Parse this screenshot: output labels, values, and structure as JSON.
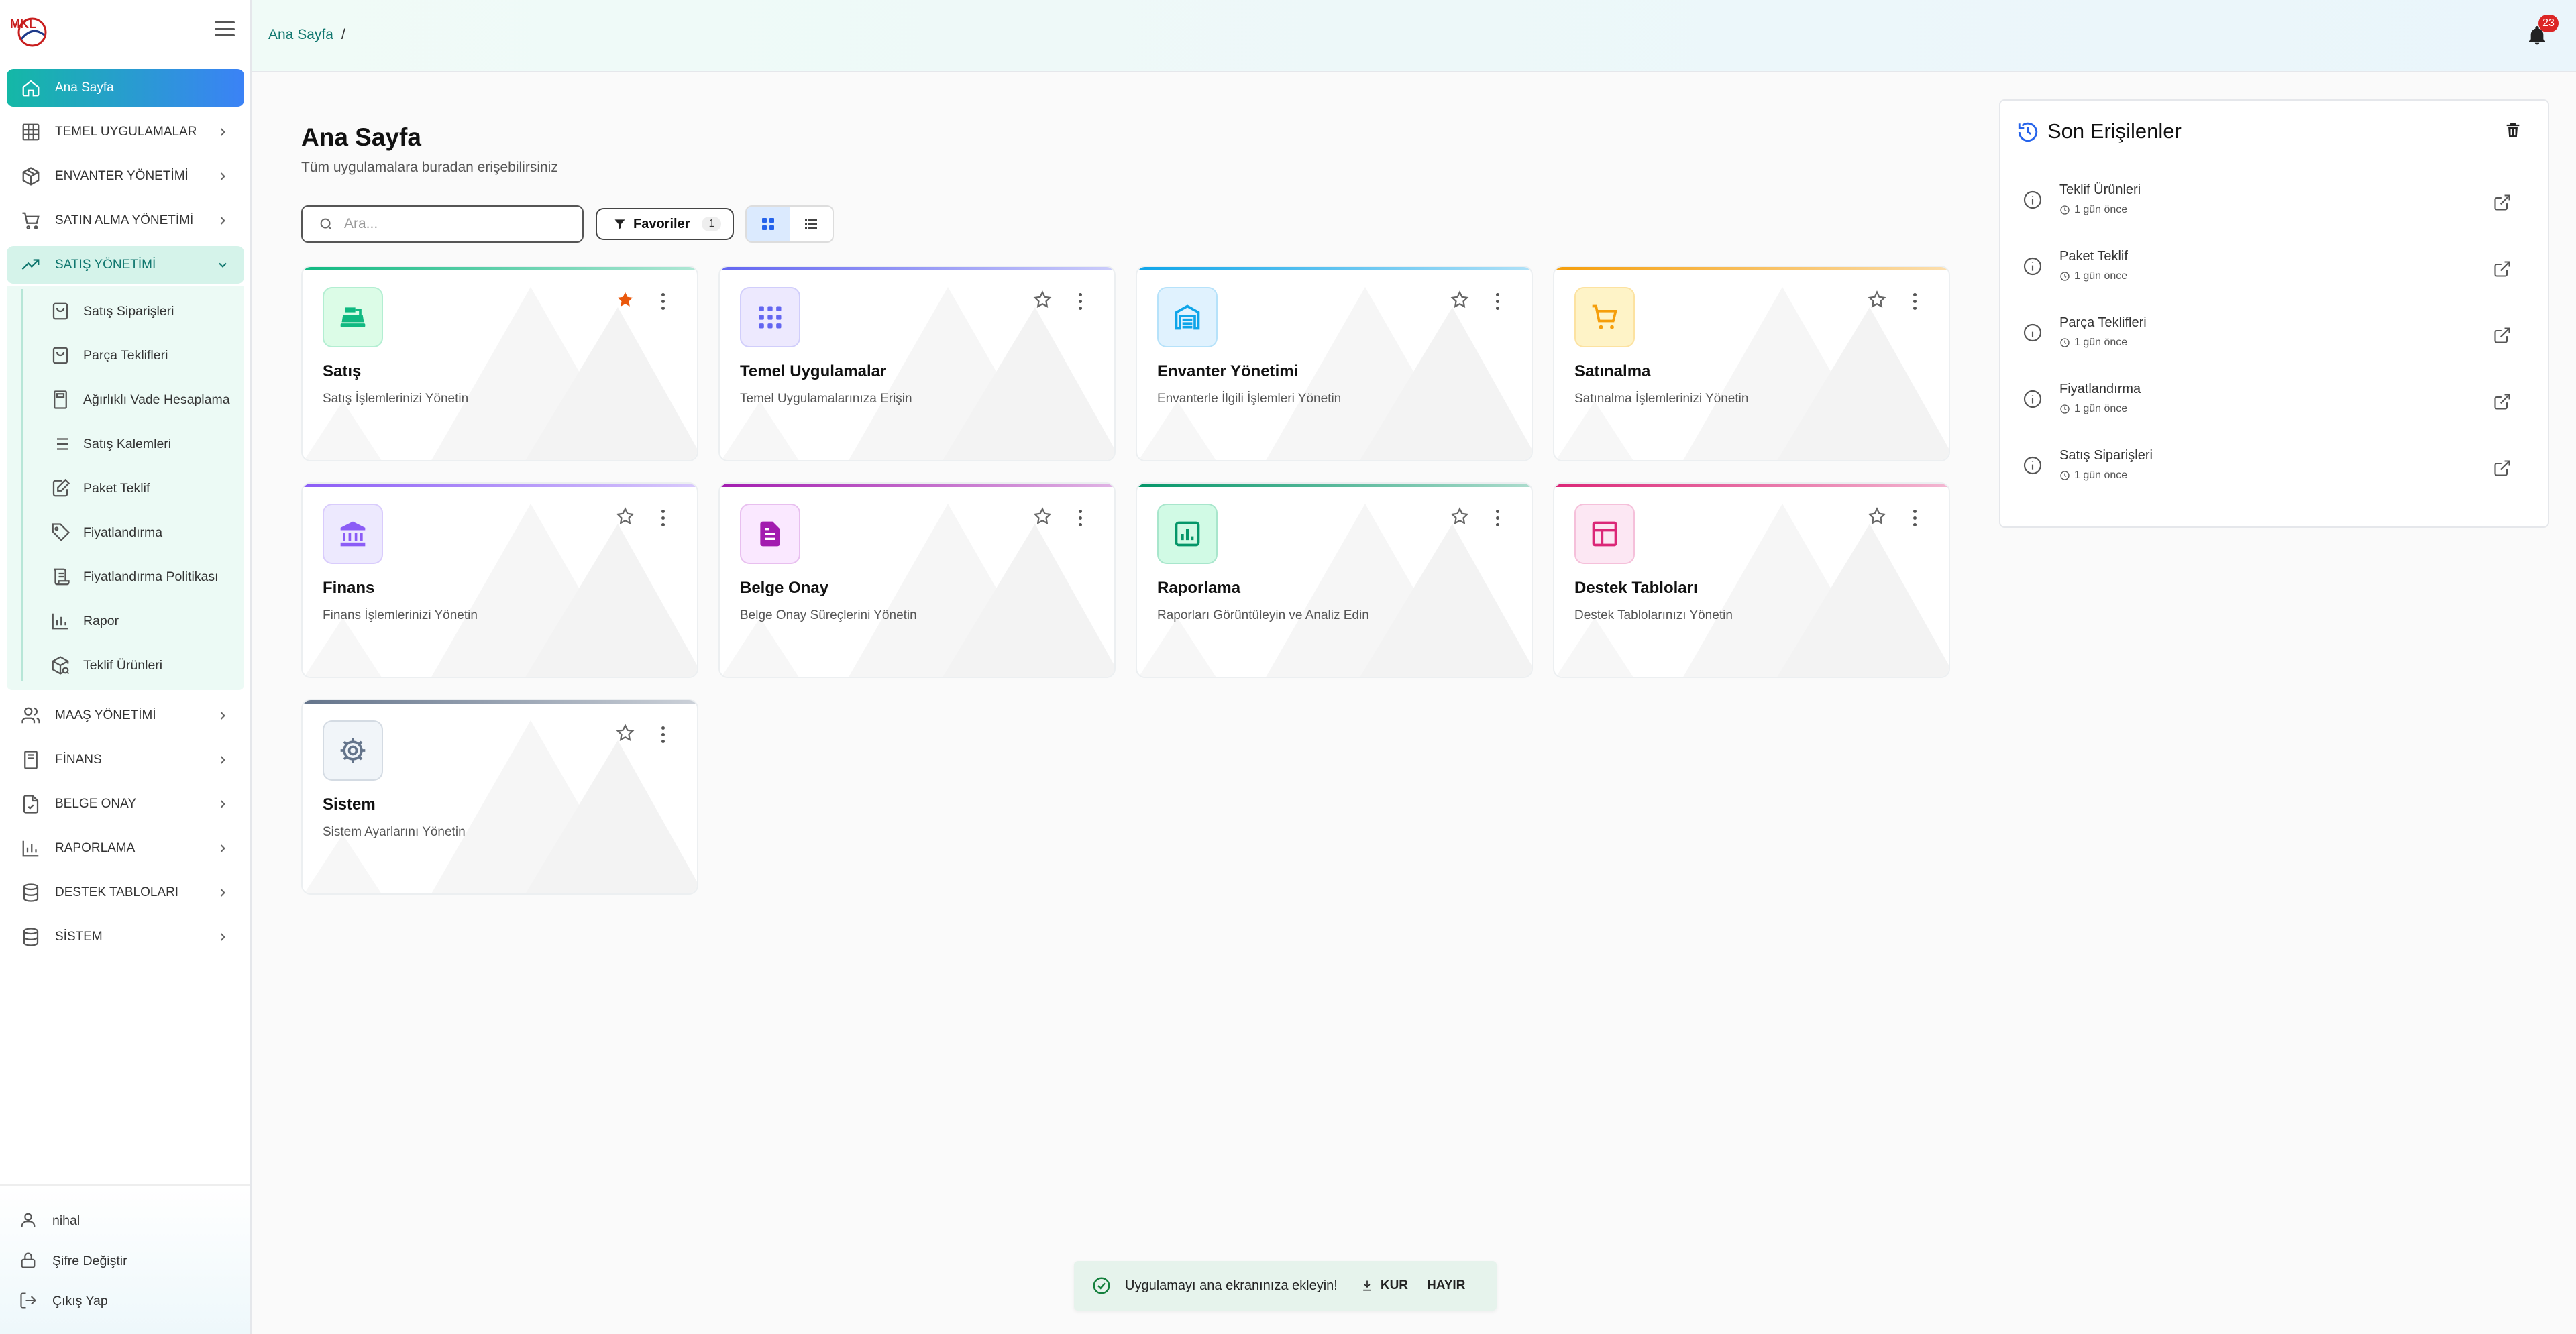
{
  "brand": {
    "logo_text": "MKL"
  },
  "sidebar": {
    "items": [
      {
        "label": "Ana Sayfa",
        "icon": "home-icon"
      },
      {
        "label": "TEMEL UYGULAMALAR",
        "icon": "grid-icon"
      },
      {
        "label": "ENVANTER YÖNETİMİ",
        "icon": "box-icon"
      },
      {
        "label": "SATIN ALMA YÖNETİMİ",
        "icon": "cart-icon"
      },
      {
        "label": "SATIŞ YÖNETİMİ",
        "icon": "trending-up-icon"
      },
      {
        "label": "MAAŞ YÖNETİMİ",
        "icon": "users-icon"
      },
      {
        "label": "FİNANS",
        "icon": "receipt-icon"
      },
      {
        "label": "BELGE ONAY",
        "icon": "file-check-icon"
      },
      {
        "label": "RAPORLAMA",
        "icon": "bar-chart-icon"
      },
      {
        "label": "DESTEK TABLOLARI",
        "icon": "database-icon"
      },
      {
        "label": "SİSTEM",
        "icon": "database-icon"
      }
    ],
    "sales_sub": [
      {
        "label": "Satış Siparişleri",
        "icon": "shopping-bag-icon"
      },
      {
        "label": "Parça Teklifleri",
        "icon": "shopping-bag-icon"
      },
      {
        "label": "Ağırlıklı Vade Hesaplama",
        "icon": "calculator-icon"
      },
      {
        "label": "Satış Kalemleri",
        "icon": "list-icon"
      },
      {
        "label": "Paket Teklif",
        "icon": "edit-icon"
      },
      {
        "label": "Fiyatlandırma",
        "icon": "tag-icon"
      },
      {
        "label": "Fiyatlandırma Politikası",
        "icon": "scroll-icon"
      },
      {
        "label": "Rapor",
        "icon": "bar-chart-icon"
      },
      {
        "label": "Teklif Ürünleri",
        "icon": "package-search-icon"
      }
    ],
    "footer": {
      "user": "nihal",
      "change_password": "Şifre Değiştir",
      "logout": "Çıkış Yap"
    }
  },
  "topbar": {
    "breadcrumb": "Ana Sayfa",
    "breadcrumb_sep": "/",
    "notification_count": "23"
  },
  "main": {
    "title": "Ana Sayfa",
    "subtitle": "Tüm uygulamalara buradan erişebilirsiniz",
    "search_placeholder": "Ara...",
    "favorites_label": "Favoriler",
    "favorites_count": "1",
    "view_mode": "grid"
  },
  "cards": [
    {
      "title": "Satış",
      "desc": "Satış İşlemlerinizi Yönetin",
      "color": "#10b981",
      "bg": "#dcfce7",
      "icon": "cash-register-icon",
      "favorite": true
    },
    {
      "title": "Temel Uygulamalar",
      "desc": "Temel Uygulamalarınıza Erişin",
      "color": "#6366f1",
      "bg": "#ede9fe",
      "icon": "apps-grid-icon",
      "favorite": false
    },
    {
      "title": "Envanter Yönetimi",
      "desc": "Envanterle İlgili İşlemleri Yönetin",
      "color": "#0ea5e9",
      "bg": "#e0f2fe",
      "icon": "warehouse-icon",
      "favorite": false
    },
    {
      "title": "Satınalma",
      "desc": "Satınalma İşlemlerinizi Yönetin",
      "color": "#f59e0b",
      "bg": "#fef3c7",
      "icon": "cart-icon",
      "favorite": false
    },
    {
      "title": "Finans",
      "desc": "Finans İşlemlerinizi Yönetin",
      "color": "#8b5cf6",
      "bg": "#ede9fe",
      "icon": "bank-icon",
      "favorite": false
    },
    {
      "title": "Belge Onay",
      "desc": "Belge Onay Süreçlerini Yönetin",
      "color": "#a21caf",
      "bg": "#fae8ff",
      "icon": "document-icon",
      "favorite": false
    },
    {
      "title": "Raporlama",
      "desc": "Raporları Görüntüleyin ve Analiz Edin",
      "color": "#059669",
      "bg": "#d1fae5",
      "icon": "analytics-icon",
      "favorite": false
    },
    {
      "title": "Destek Tabloları",
      "desc": "Destek Tablolarınızı Yönetin",
      "color": "#db2777",
      "bg": "#fce7f3",
      "icon": "table-icon",
      "favorite": false
    },
    {
      "title": "Sistem",
      "desc": "Sistem Ayarlarını Yönetin",
      "color": "#64748b",
      "bg": "#f1f5f9",
      "icon": "gear-icon",
      "favorite": false
    }
  ],
  "recent": {
    "title": "Son Erişilenler",
    "items": [
      {
        "name": "Teklif Ürünleri",
        "time": "1 gün önce"
      },
      {
        "name": "Paket Teklif",
        "time": "1 gün önce"
      },
      {
        "name": "Parça Teklifleri",
        "time": "1 gün önce"
      },
      {
        "name": "Fiyatlandırma",
        "time": "1 gün önce"
      },
      {
        "name": "Satış Siparişleri",
        "time": "1 gün önce"
      }
    ]
  },
  "toast": {
    "message": "Uygulamayı ana ekranınıza ekleyin!",
    "install": "KUR",
    "dismiss": "HAYIR"
  }
}
